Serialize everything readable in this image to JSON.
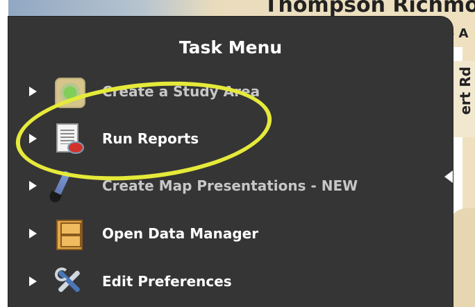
{
  "map": {
    "top_text": "Thompson Richmo",
    "right_label": "e A",
    "right_road": "ert Rd"
  },
  "panel": {
    "title": "Task Menu",
    "items": [
      {
        "label": "Create a Study Area",
        "icon": "study-area-icon"
      },
      {
        "label": "Run Reports",
        "icon": "report-icon"
      },
      {
        "label": "Create Map Presentations - NEW",
        "icon": "paintbrush-icon"
      },
      {
        "label": "Open Data Manager",
        "icon": "file-cabinet-icon"
      },
      {
        "label": "Edit Preferences",
        "icon": "tools-icon"
      }
    ]
  },
  "annotation": {
    "color": "#e5ea3a",
    "target": "Run Reports"
  },
  "colors": {
    "panel_bg": "#363535",
    "text": "#ffffff",
    "highlight": "#e5ea3a"
  }
}
